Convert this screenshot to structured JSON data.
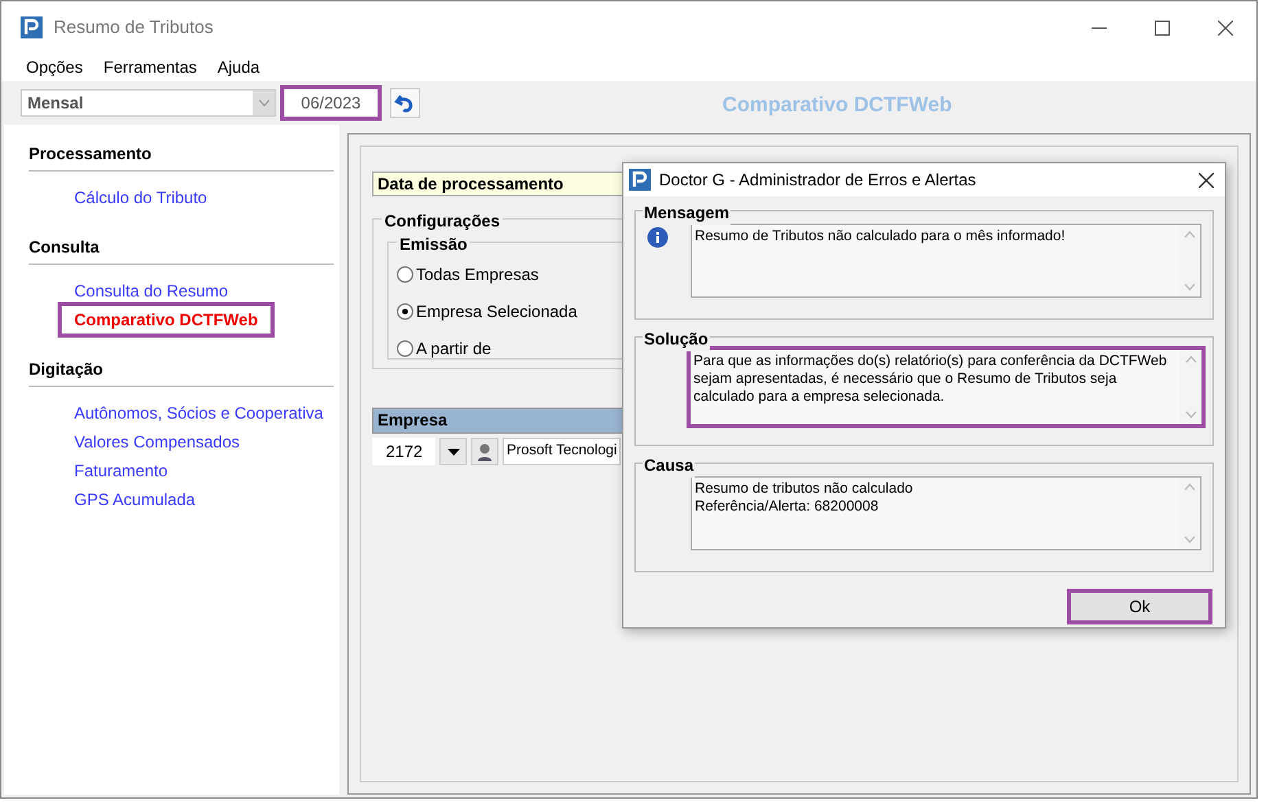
{
  "window": {
    "title": "Resumo de Tributos"
  },
  "menu": [
    "Opções",
    "Ferramentas",
    "Ajuda"
  ],
  "toolbar": {
    "period": "Mensal",
    "date": {
      "value": "06/2023",
      "highlighted": true
    }
  },
  "page_title": "Comparativo DCTFWeb",
  "sidebar": [
    {
      "title": "Processamento",
      "items": [
        {
          "label": "Cálculo do Tributo",
          "selected": false,
          "highlighted": false
        }
      ]
    },
    {
      "title": "Consulta",
      "items": [
        {
          "label": "Consulta do Resumo",
          "selected": false,
          "highlighted": false
        },
        {
          "label": "Comparativo DCTFWeb",
          "selected": true,
          "highlighted": true
        }
      ]
    },
    {
      "title": "Digitação",
      "items": [
        {
          "label": "Autônomos, Sócios e Cooperativa",
          "selected": false,
          "highlighted": false
        },
        {
          "label": "Valores Compensados",
          "selected": false,
          "highlighted": false
        },
        {
          "label": "Faturamento",
          "selected": false,
          "highlighted": false
        },
        {
          "label": "GPS Acumulada",
          "selected": false,
          "highlighted": false
        }
      ]
    }
  ],
  "form": {
    "date_header": "Data de processamento",
    "config_title": "Configurações",
    "emission_title": "Emissão",
    "options": [
      {
        "label": "Todas Empresas",
        "selected": false
      },
      {
        "label": "Empresa Selecionada",
        "selected": true
      },
      {
        "label": "A partir de",
        "selected": false
      }
    ],
    "company_header": "Empresa",
    "company_code": "2172",
    "company_name": "Prosoft Tecnologi"
  },
  "dialog": {
    "title": "Doctor G - Administrador de Erros e Alertas",
    "sections": [
      {
        "title": "Mensagem",
        "text": "Resumo de Tributos não calculado para o mês informado!",
        "info_icon": true,
        "highlighted": false
      },
      {
        "title": "Solução",
        "text": "Para que as informações do(s) relatório(s) para conferência da DCTFWeb\nsejam apresentadas, é necessário que o Resumo de Tributos seja\ncalculado para a empresa selecionada.",
        "info_icon": false,
        "highlighted": true
      },
      {
        "title": "Causa",
        "text": "Resumo de tributos não calculado\nReferência/Alerta: 68200008",
        "info_icon": false,
        "highlighted": false
      }
    ],
    "button": {
      "label": "Ok",
      "highlighted": true
    }
  }
}
